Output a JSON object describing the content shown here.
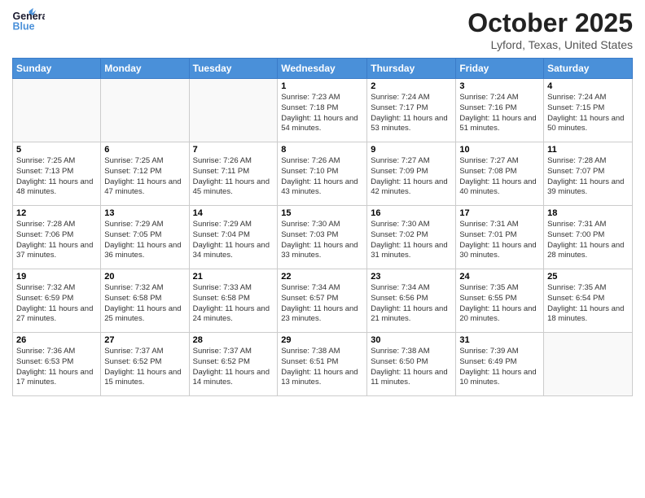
{
  "header": {
    "logo_general": "General",
    "logo_blue": "Blue",
    "month_title": "October 2025",
    "location": "Lyford, Texas, United States"
  },
  "weekdays": [
    "Sunday",
    "Monday",
    "Tuesday",
    "Wednesday",
    "Thursday",
    "Friday",
    "Saturday"
  ],
  "weeks": [
    [
      {
        "day": "",
        "info": "",
        "empty": true
      },
      {
        "day": "",
        "info": "",
        "empty": true
      },
      {
        "day": "",
        "info": "",
        "empty": true
      },
      {
        "day": "1",
        "info": "Sunrise: 7:23 AM\nSunset: 7:18 PM\nDaylight: 11 hours\nand 54 minutes.",
        "empty": false
      },
      {
        "day": "2",
        "info": "Sunrise: 7:24 AM\nSunset: 7:17 PM\nDaylight: 11 hours\nand 53 minutes.",
        "empty": false
      },
      {
        "day": "3",
        "info": "Sunrise: 7:24 AM\nSunset: 7:16 PM\nDaylight: 11 hours\nand 51 minutes.",
        "empty": false
      },
      {
        "day": "4",
        "info": "Sunrise: 7:24 AM\nSunset: 7:15 PM\nDaylight: 11 hours\nand 50 minutes.",
        "empty": false
      }
    ],
    [
      {
        "day": "5",
        "info": "Sunrise: 7:25 AM\nSunset: 7:13 PM\nDaylight: 11 hours\nand 48 minutes.",
        "empty": false
      },
      {
        "day": "6",
        "info": "Sunrise: 7:25 AM\nSunset: 7:12 PM\nDaylight: 11 hours\nand 47 minutes.",
        "empty": false
      },
      {
        "day": "7",
        "info": "Sunrise: 7:26 AM\nSunset: 7:11 PM\nDaylight: 11 hours\nand 45 minutes.",
        "empty": false
      },
      {
        "day": "8",
        "info": "Sunrise: 7:26 AM\nSunset: 7:10 PM\nDaylight: 11 hours\nand 43 minutes.",
        "empty": false
      },
      {
        "day": "9",
        "info": "Sunrise: 7:27 AM\nSunset: 7:09 PM\nDaylight: 11 hours\nand 42 minutes.",
        "empty": false
      },
      {
        "day": "10",
        "info": "Sunrise: 7:27 AM\nSunset: 7:08 PM\nDaylight: 11 hours\nand 40 minutes.",
        "empty": false
      },
      {
        "day": "11",
        "info": "Sunrise: 7:28 AM\nSunset: 7:07 PM\nDaylight: 11 hours\nand 39 minutes.",
        "empty": false
      }
    ],
    [
      {
        "day": "12",
        "info": "Sunrise: 7:28 AM\nSunset: 7:06 PM\nDaylight: 11 hours\nand 37 minutes.",
        "empty": false
      },
      {
        "day": "13",
        "info": "Sunrise: 7:29 AM\nSunset: 7:05 PM\nDaylight: 11 hours\nand 36 minutes.",
        "empty": false
      },
      {
        "day": "14",
        "info": "Sunrise: 7:29 AM\nSunset: 7:04 PM\nDaylight: 11 hours\nand 34 minutes.",
        "empty": false
      },
      {
        "day": "15",
        "info": "Sunrise: 7:30 AM\nSunset: 7:03 PM\nDaylight: 11 hours\nand 33 minutes.",
        "empty": false
      },
      {
        "day": "16",
        "info": "Sunrise: 7:30 AM\nSunset: 7:02 PM\nDaylight: 11 hours\nand 31 minutes.",
        "empty": false
      },
      {
        "day": "17",
        "info": "Sunrise: 7:31 AM\nSunset: 7:01 PM\nDaylight: 11 hours\nand 30 minutes.",
        "empty": false
      },
      {
        "day": "18",
        "info": "Sunrise: 7:31 AM\nSunset: 7:00 PM\nDaylight: 11 hours\nand 28 minutes.",
        "empty": false
      }
    ],
    [
      {
        "day": "19",
        "info": "Sunrise: 7:32 AM\nSunset: 6:59 PM\nDaylight: 11 hours\nand 27 minutes.",
        "empty": false
      },
      {
        "day": "20",
        "info": "Sunrise: 7:32 AM\nSunset: 6:58 PM\nDaylight: 11 hours\nand 25 minutes.",
        "empty": false
      },
      {
        "day": "21",
        "info": "Sunrise: 7:33 AM\nSunset: 6:58 PM\nDaylight: 11 hours\nand 24 minutes.",
        "empty": false
      },
      {
        "day": "22",
        "info": "Sunrise: 7:34 AM\nSunset: 6:57 PM\nDaylight: 11 hours\nand 23 minutes.",
        "empty": false
      },
      {
        "day": "23",
        "info": "Sunrise: 7:34 AM\nSunset: 6:56 PM\nDaylight: 11 hours\nand 21 minutes.",
        "empty": false
      },
      {
        "day": "24",
        "info": "Sunrise: 7:35 AM\nSunset: 6:55 PM\nDaylight: 11 hours\nand 20 minutes.",
        "empty": false
      },
      {
        "day": "25",
        "info": "Sunrise: 7:35 AM\nSunset: 6:54 PM\nDaylight: 11 hours\nand 18 minutes.",
        "empty": false
      }
    ],
    [
      {
        "day": "26",
        "info": "Sunrise: 7:36 AM\nSunset: 6:53 PM\nDaylight: 11 hours\nand 17 minutes.",
        "empty": false
      },
      {
        "day": "27",
        "info": "Sunrise: 7:37 AM\nSunset: 6:52 PM\nDaylight: 11 hours\nand 15 minutes.",
        "empty": false
      },
      {
        "day": "28",
        "info": "Sunrise: 7:37 AM\nSunset: 6:52 PM\nDaylight: 11 hours\nand 14 minutes.",
        "empty": false
      },
      {
        "day": "29",
        "info": "Sunrise: 7:38 AM\nSunset: 6:51 PM\nDaylight: 11 hours\nand 13 minutes.",
        "empty": false
      },
      {
        "day": "30",
        "info": "Sunrise: 7:38 AM\nSunset: 6:50 PM\nDaylight: 11 hours\nand 11 minutes.",
        "empty": false
      },
      {
        "day": "31",
        "info": "Sunrise: 7:39 AM\nSunset: 6:49 PM\nDaylight: 11 hours\nand 10 minutes.",
        "empty": false
      },
      {
        "day": "",
        "info": "",
        "empty": true
      }
    ]
  ]
}
